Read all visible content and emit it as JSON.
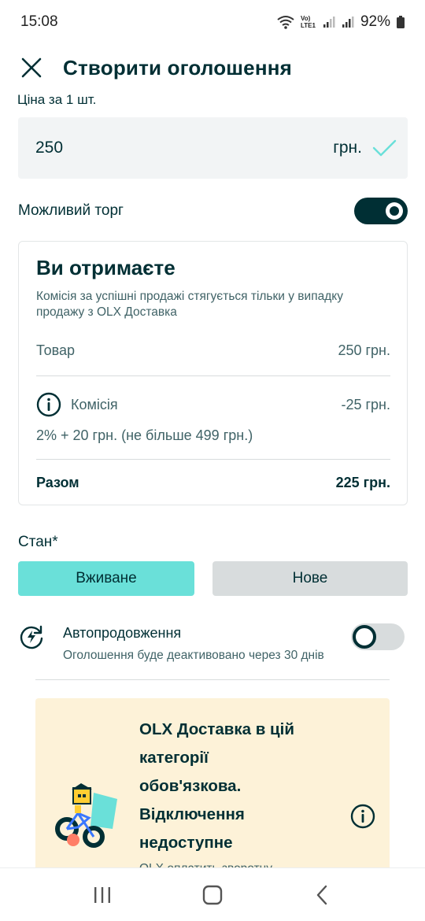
{
  "status_bar": {
    "time": "15:08",
    "network": "Vo) LTE1",
    "battery": "92%"
  },
  "header": {
    "title": "Створити оголошення"
  },
  "price": {
    "label": "Ціна за 1 шт.",
    "value": "250",
    "unit": "грн."
  },
  "haggle": {
    "label": "Можливий торг",
    "enabled": true
  },
  "receive": {
    "title": "Ви отримаєте",
    "note": "Комісія за успішні продажі стягується тільки у випадку продажу з OLX Доставка",
    "goods_label": "Товар",
    "goods_value": "250 грн.",
    "fee_label": "Комісія",
    "fee_value": "-25 грн.",
    "fee_formula": "2% + 20 грн. (не більше 499 грн.)",
    "total_label": "Разом",
    "total_value": "225 грн."
  },
  "condition": {
    "label": "Стан*",
    "options": [
      "Вживане",
      "Нове"
    ],
    "selected": "Вживане"
  },
  "autorenew": {
    "title": "Автопродовження",
    "description": "Оголошення буде деактивовано через 30 днів",
    "enabled": false
  },
  "delivery_banner": {
    "title": "OLX Доставка в цій категорії обов'язкова. Відключення недоступне",
    "cut_text": "OLX оплатить зворотну"
  },
  "colors": {
    "accent": "#6ae0d9",
    "dark": "#002f34",
    "banner_bg": "#fdf2d8",
    "muted": "#406367"
  },
  "icons": [
    "close-icon",
    "check-icon",
    "info-icon",
    "autorenew-icon",
    "bike-delivery-illustration",
    "recents-icon",
    "home-icon",
    "back-icon"
  ]
}
